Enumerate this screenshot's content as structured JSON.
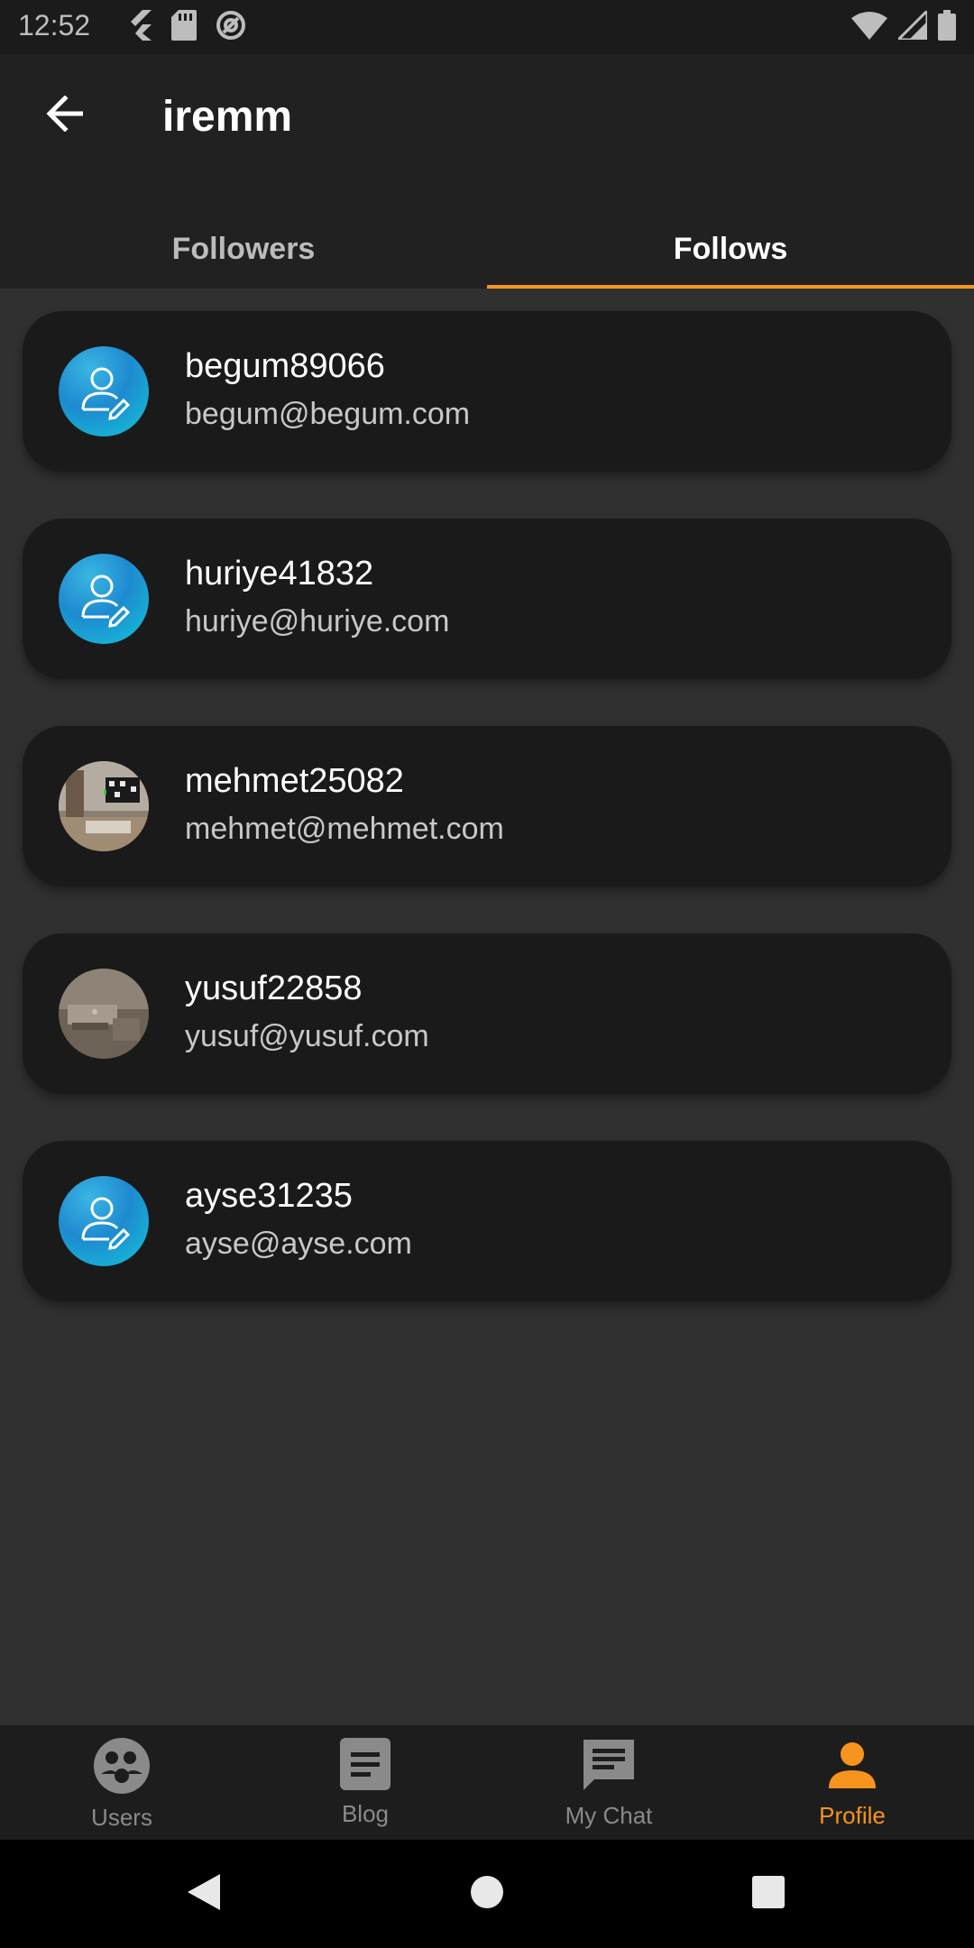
{
  "status_bar": {
    "time": "12:52",
    "left_icons": [
      "flutter-icon",
      "sd-card-icon",
      "sync-icon"
    ],
    "right_icons": [
      "wifi-icon",
      "signal-icon",
      "battery-icon"
    ]
  },
  "app_bar": {
    "back_icon": "arrow-back-icon",
    "title": "iremm"
  },
  "tabs": [
    {
      "label": "Followers",
      "active": false
    },
    {
      "label": "Follows",
      "active": true
    }
  ],
  "follows": [
    {
      "name": "begum89066",
      "email": "begum@begum.com",
      "avatar": "default-avatar"
    },
    {
      "name": "huriye41832",
      "email": "huriye@huriye.com",
      "avatar": "default-avatar"
    },
    {
      "name": "mehmet25082",
      "email": "mehmet@mehmet.com",
      "avatar": "room-photo"
    },
    {
      "name": "yusuf22858",
      "email": "yusuf@yusuf.com",
      "avatar": "room-photo"
    },
    {
      "name": "ayse31235",
      "email": "ayse@ayse.com",
      "avatar": "default-avatar"
    }
  ],
  "bottom_nav": [
    {
      "label": "Users",
      "icon": "users-icon",
      "active": false
    },
    {
      "label": "Blog",
      "icon": "blog-icon",
      "active": false
    },
    {
      "label": "My Chat",
      "icon": "chat-icon",
      "active": false
    },
    {
      "label": "Profile",
      "icon": "person-icon",
      "active": true
    }
  ],
  "colors": {
    "accent": "#f7941d",
    "background": "#303030",
    "card": "#1a1a1a",
    "app_bar": "#212121"
  }
}
